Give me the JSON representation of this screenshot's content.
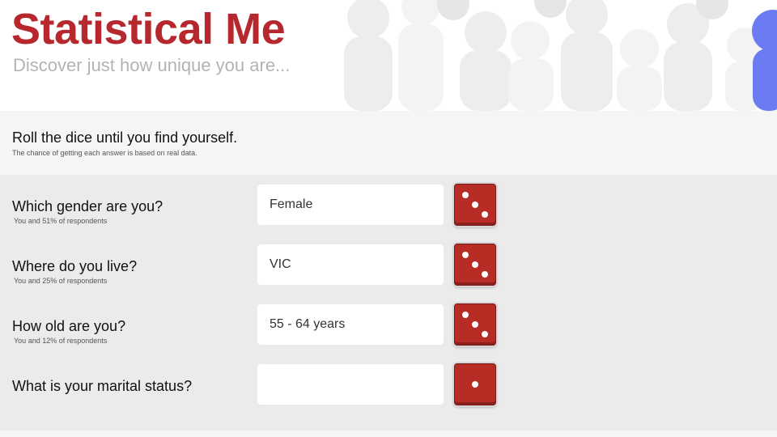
{
  "header": {
    "title": "Statistical Me",
    "subtitle": "Discover just how unique you are..."
  },
  "intro": {
    "title": "Roll the dice until you find yourself.",
    "note": "The chance of getting each answer is based on real data."
  },
  "questions": [
    {
      "label": "Which gender are you?",
      "answer": "Female",
      "stat": "You and 51% of respondents",
      "dice_icon": "dice-three-icon"
    },
    {
      "label": "Where do you live?",
      "answer": "VIC",
      "stat": "You and 25% of respondents",
      "dice_icon": "dice-three-icon"
    },
    {
      "label": "How old are you?",
      "answer": "55 - 64 years",
      "stat": "You and 12% of respondents",
      "dice_icon": "dice-three-icon"
    },
    {
      "label": "What is your marital status?",
      "answer": "",
      "stat": "",
      "dice_icon": "dice-one-icon"
    }
  ],
  "colors": {
    "brand_red": "#b7282e",
    "dice_red": "#b82c26",
    "subtitle_gray": "#b3b3b3",
    "accent_blue": "#6b7cf2"
  }
}
